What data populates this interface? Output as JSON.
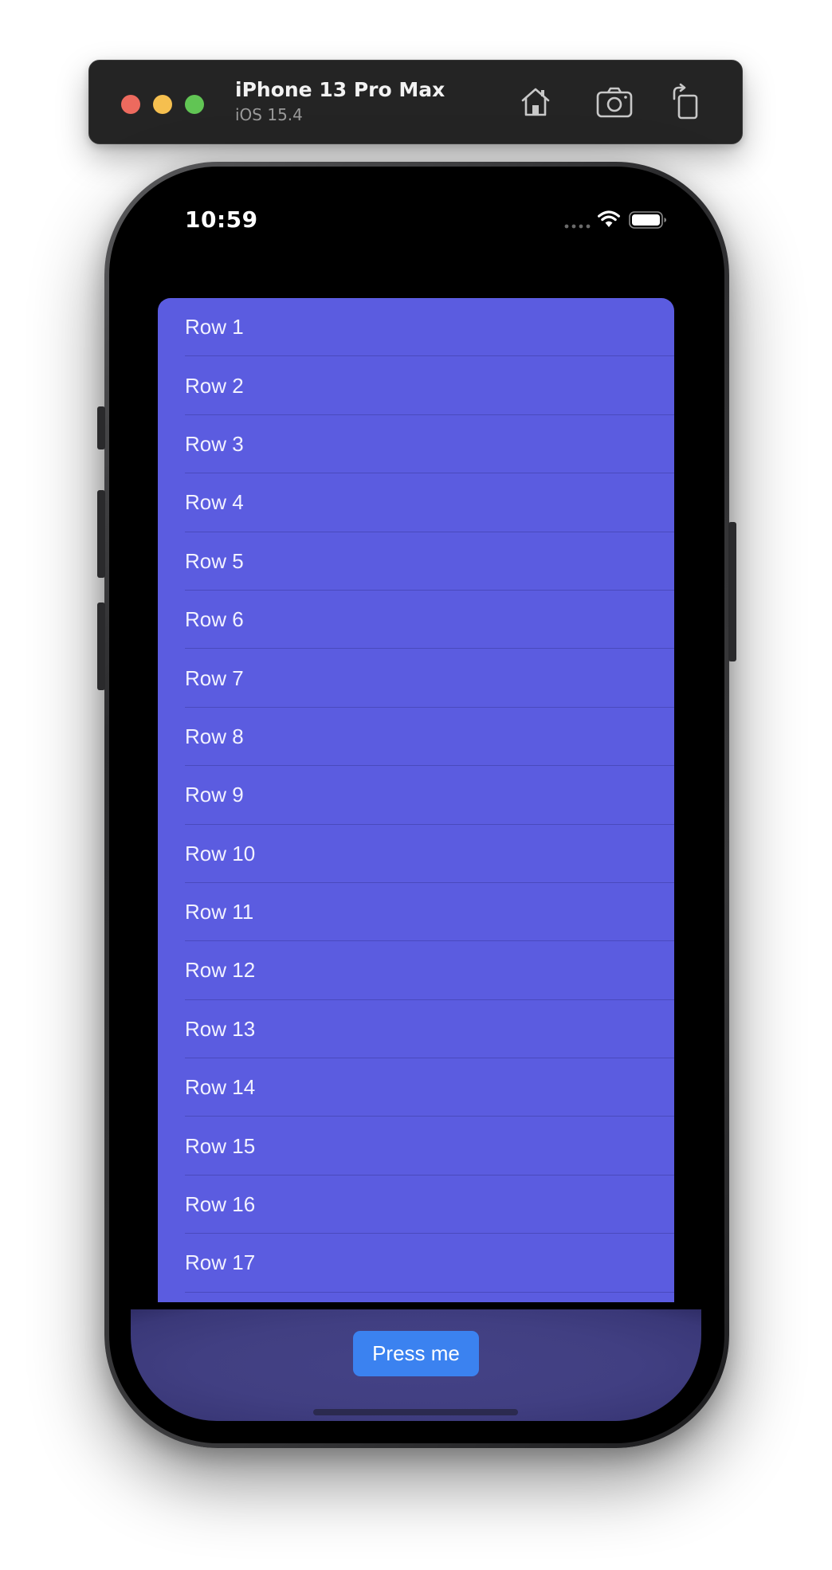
{
  "simulator": {
    "device_name": "iPhone 13 Pro Max",
    "os_version": "iOS 15.4",
    "toolbar_icons": [
      "home-icon",
      "screenshot-icon",
      "rotate-icon"
    ]
  },
  "status_bar": {
    "time": "10:59"
  },
  "list": {
    "rows": [
      {
        "label": "Row 1"
      },
      {
        "label": "Row 2"
      },
      {
        "label": "Row 3"
      },
      {
        "label": "Row 4"
      },
      {
        "label": "Row 5"
      },
      {
        "label": "Row 6"
      },
      {
        "label": "Row 7"
      },
      {
        "label": "Row 8"
      },
      {
        "label": "Row 9"
      },
      {
        "label": "Row 10"
      },
      {
        "label": "Row 11"
      },
      {
        "label": "Row 12"
      },
      {
        "label": "Row 13"
      },
      {
        "label": "Row 14"
      },
      {
        "label": "Row 15"
      },
      {
        "label": "Row 16"
      },
      {
        "label": "Row 17"
      }
    ]
  },
  "bottom_bar": {
    "button_label": "Press me"
  },
  "colors": {
    "list_background": "#5b5ce0",
    "button_background": "#3b82f0",
    "bottom_bar_background": "#413f82"
  }
}
